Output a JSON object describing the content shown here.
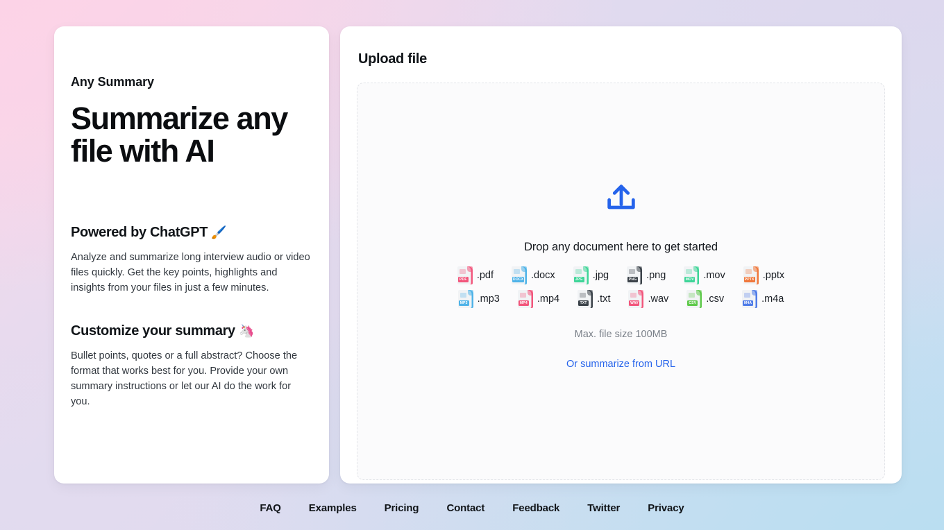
{
  "theme": {
    "accent_blue": "#2563eb",
    "card_bg": "#ffffff",
    "dropzone_bg": "#fbfbfc",
    "bg_gradient_stops": [
      "#fcd6e8",
      "#e6dcf0",
      "#dcdcf0",
      "#c6e0f2"
    ]
  },
  "left": {
    "brand": "Any Summary",
    "hero": "Summarize any file with AI",
    "features": [
      {
        "title": "Powered by ChatGPT",
        "emoji": "🖌️",
        "body": "Analyze and summarize long interview audio or video files quickly. Get the key points, highlights and insights from your files in just a few minutes."
      },
      {
        "title": "Customize your summary",
        "emoji": "🦄",
        "body": "Bullet points, quotes or a full abstract? Choose the format that works best for you. Provide your own summary instructions or let our AI do the work for you."
      }
    ]
  },
  "upload": {
    "panel_title": "Upload file",
    "icon": "upload-tray-icon",
    "drop_text": "Drop any document here to get started",
    "max_size": "Max. file size 100MB",
    "url_link": "Or summarize from URL",
    "file_types_row1": [
      {
        "label": ".pdf",
        "tag": "PDF",
        "color": "#f2567c"
      },
      {
        "label": ".docx",
        "tag": "DOCX",
        "color": "#4fb3e8"
      },
      {
        "label": ".jpg",
        "tag": "JPG",
        "color": "#3ed598"
      },
      {
        "label": ".png",
        "tag": "PNG",
        "color": "#3b4249"
      },
      {
        "label": ".mov",
        "tag": "MOV",
        "color": "#3ed598"
      },
      {
        "label": ".pptx",
        "tag": "PPTX",
        "color": "#f0783c"
      }
    ],
    "file_types_row2": [
      {
        "label": ".mp3",
        "tag": "MP3",
        "color": "#4fb3e8"
      },
      {
        "label": ".mp4",
        "tag": "MP4",
        "color": "#f2567c"
      },
      {
        "label": ".txt",
        "tag": "TXT",
        "color": "#3b4249"
      },
      {
        "label": ".wav",
        "tag": "WAV",
        "color": "#f2567c"
      },
      {
        "label": ".csv",
        "tag": "CSV",
        "color": "#5ec94a"
      },
      {
        "label": ".m4a",
        "tag": "M4A",
        "color": "#4f7ce8"
      }
    ]
  },
  "footer": {
    "links": [
      "FAQ",
      "Examples",
      "Pricing",
      "Contact",
      "Feedback",
      "Twitter",
      "Privacy"
    ]
  }
}
